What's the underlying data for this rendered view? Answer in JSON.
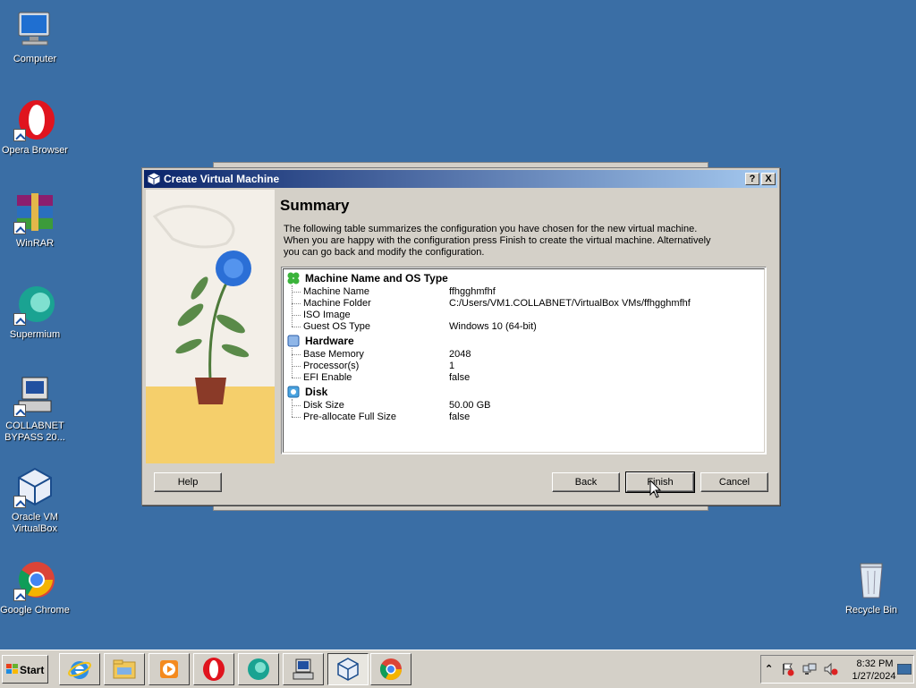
{
  "desktop": {
    "icons": [
      {
        "label": "Computer"
      },
      {
        "label": "Opera Browser"
      },
      {
        "label": "WinRAR"
      },
      {
        "label": "Supermium"
      },
      {
        "label": "COLLABNET BYPASS 20..."
      },
      {
        "label": "Oracle VM VirtualBox"
      },
      {
        "label": "Google Chrome"
      },
      {
        "label": "Recycle Bin"
      }
    ]
  },
  "dialog": {
    "title": "Create Virtual Machine",
    "help_btn": "?",
    "close_btn": "X",
    "heading": "Summary",
    "description": [
      "The following table summarizes the configuration you have chosen for the new virtual machine.",
      "When you are happy with the configuration press Finish to create the virtual machine. Alternatively",
      "you can go back and modify the configuration."
    ],
    "sections": [
      {
        "title": "Machine Name and OS Type",
        "rows": [
          {
            "key": "Machine Name",
            "value": "ffhgghmfhf"
          },
          {
            "key": "Machine Folder",
            "value": "C:/Users/VM1.COLLABNET/VirtualBox VMs/ffhgghmfhf"
          },
          {
            "key": "ISO Image",
            "value": ""
          },
          {
            "key": "Guest OS Type",
            "value": "Windows 10 (64-bit)"
          }
        ]
      },
      {
        "title": "Hardware",
        "rows": [
          {
            "key": "Base Memory",
            "value": "2048"
          },
          {
            "key": "Processor(s)",
            "value": "1"
          },
          {
            "key": "EFI Enable",
            "value": "false"
          }
        ]
      },
      {
        "title": "Disk",
        "rows": [
          {
            "key": "Disk Size",
            "value": "50.00 GB"
          },
          {
            "key": "Pre-allocate Full Size",
            "value": "false"
          }
        ]
      }
    ],
    "buttons": {
      "help": "Help",
      "back": "Back",
      "finish": "Finish",
      "cancel": "Cancel"
    }
  },
  "taskbar": {
    "start_label": "Start",
    "apps": [
      "internet-explorer",
      "file-explorer",
      "media-player",
      "opera",
      "supermium",
      "collabnet-bypass",
      "virtualbox",
      "chrome"
    ],
    "tray": {
      "time": "8:32 PM",
      "date": "1/27/2024"
    }
  },
  "colors": {
    "desktop": "#3a6ea5",
    "title_gradient_start": "#0a246a",
    "title_gradient_end": "#a6caf0"
  }
}
